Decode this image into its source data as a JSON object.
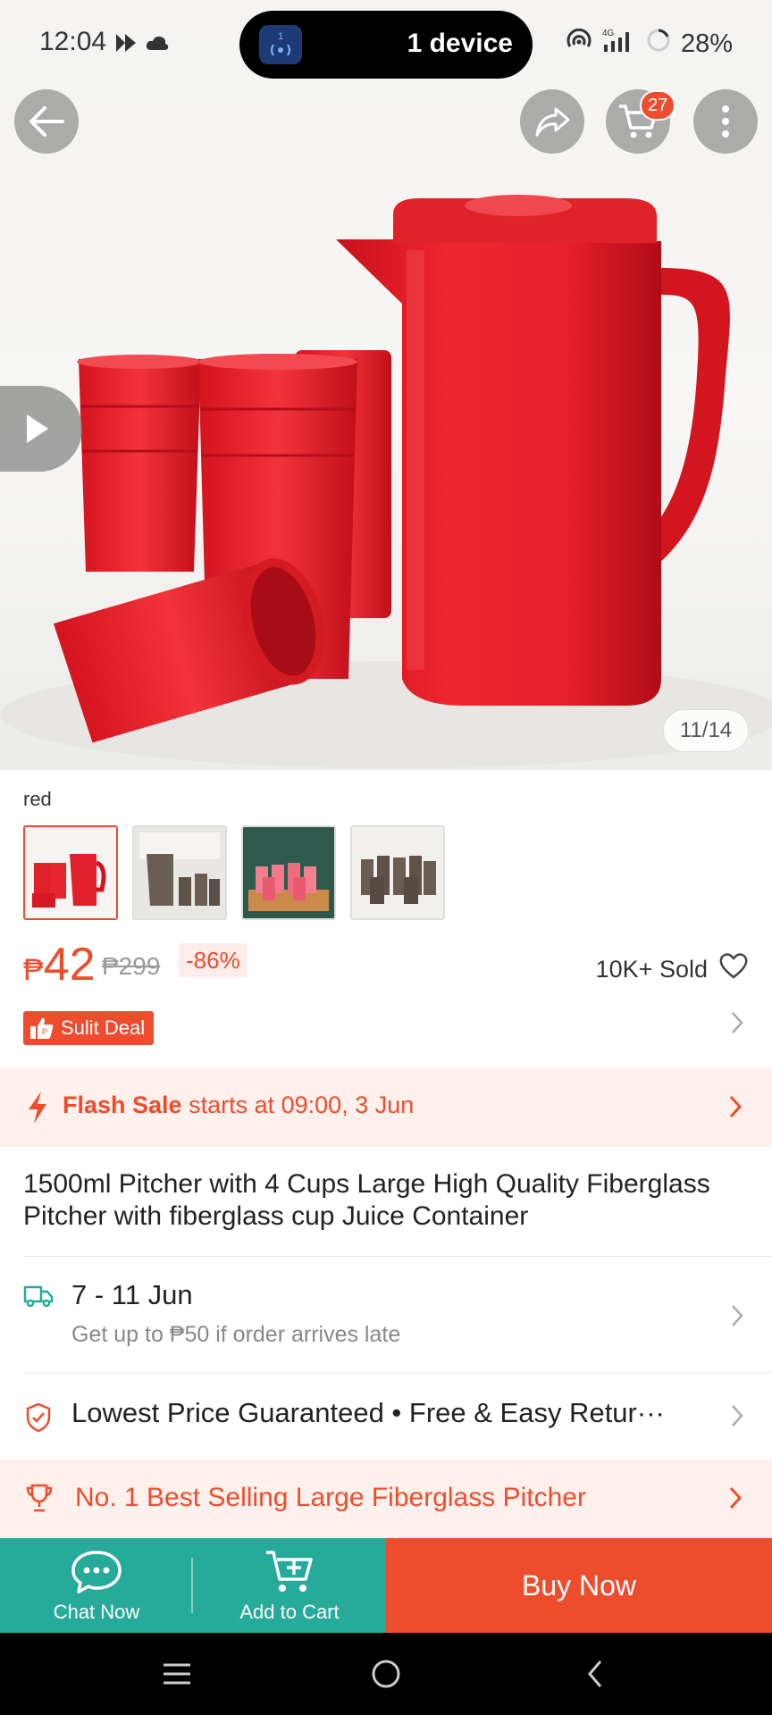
{
  "status_bar": {
    "time": "12:04",
    "device_pill": "1 device",
    "device_pill_badge": "1",
    "network": "4G",
    "battery": "28%"
  },
  "top_nav": {
    "cart_count": "27",
    "icons": [
      "back-arrow-icon",
      "share-icon",
      "cart-icon",
      "more-vertical-icon"
    ]
  },
  "gallery": {
    "counter": "11/14",
    "variant_label": "red",
    "thumbnails": [
      "red pitcher set",
      "brown pitcher set",
      "red cups on tray",
      "brown cups set"
    ],
    "selected_thumbnail": 0
  },
  "pricing": {
    "currency": "₱",
    "price": "42",
    "original_price": "₱299",
    "discount": "-86%",
    "sold": "10K+ Sold",
    "deal_badge": "Sulit Deal"
  },
  "flash_sale": {
    "label": "Flash Sale",
    "text": "starts at 09:00, 3 Jun"
  },
  "product": {
    "title": "1500ml Pitcher with 4 Cups Large High Quality Fiberglass Pitcher with fiberglass cup Juice Container"
  },
  "shipping": {
    "date_range": "7 - 11 Jun",
    "late_guarantee": "Get up to ₱50 if order arrives late"
  },
  "guarantees": {
    "text": "Lowest Price Guaranteed  •  Free & Easy Retur···"
  },
  "ranking": {
    "text": "No. 1 Best Selling Large Fiberglass Pitcher"
  },
  "actions": {
    "chat": "Chat Now",
    "add_to_cart": "Add to Cart",
    "buy_now": "Buy Now"
  },
  "colors": {
    "accent": "#ee4d2d",
    "teal": "#26aa99",
    "flash_bg": "#fdf0ed"
  }
}
